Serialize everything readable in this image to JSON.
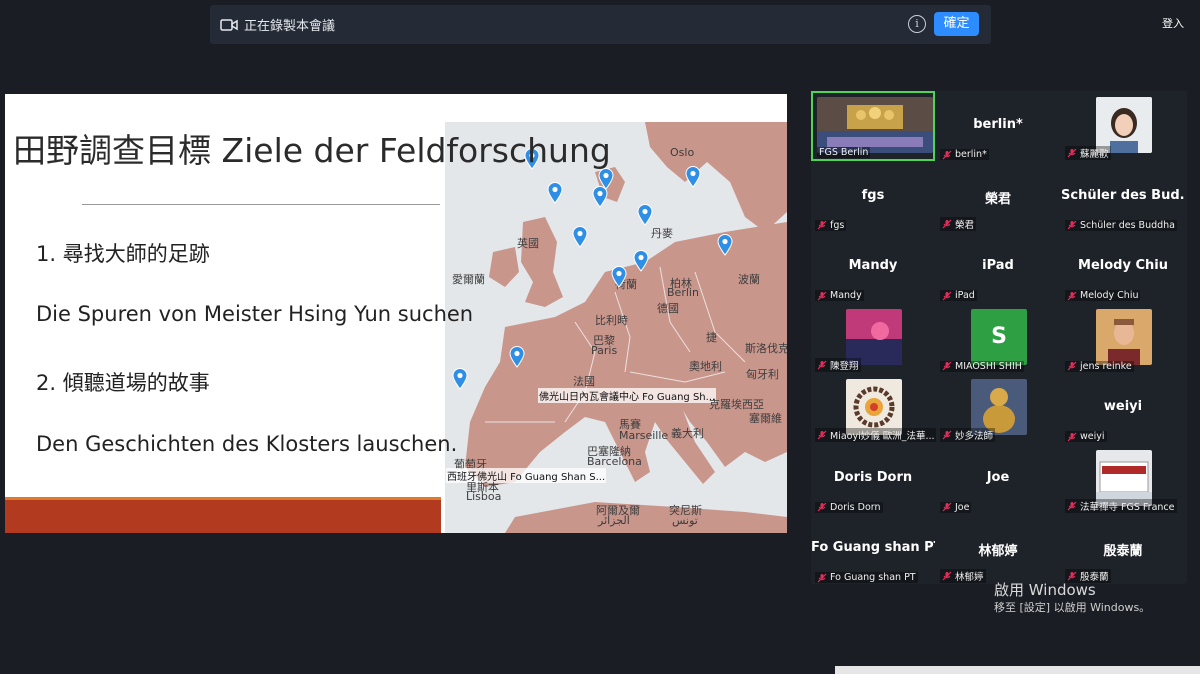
{
  "meeting": {
    "recording_text": "正在錄製本會議",
    "ok_label": "確定",
    "info_glyph": "i",
    "login_label": "登入"
  },
  "slide": {
    "title": "田野調查目標 Ziele der Feldforschung",
    "point1_zh": "1. 尋找大師的足跡",
    "point1_de": "Die Spuren von Meister Hsing Yun suchen",
    "point2_zh": "2. 傾聽道場的故事",
    "point2_de": "Den Geschichten des Klosters lauschen.",
    "map_labels": {
      "oslo": "Oslo",
      "uk": "英國",
      "ireland": "愛爾蘭",
      "denmark": "丹麥",
      "netherlands": "荷蘭",
      "berlin_zh": "柏林",
      "berlin": "Berlin",
      "poland": "波蘭",
      "germany": "德國",
      "belgium": "比利時",
      "paris_zh": "巴黎",
      "paris": "Paris",
      "czech": "捷",
      "slovakia": "斯洛伐克",
      "austria": "奧地利",
      "hungary": "匈牙利",
      "france": "法國",
      "geneva_tag": "佛光山日內瓦會議中心 Fo Guang Sh...",
      "croatia": "克羅埃西亞",
      "serbia": "塞爾維",
      "marseille": "Marseille",
      "italy": "義大利",
      "barcelona_zh": "巴塞隆納",
      "barcelona": "Barcelona",
      "portugal": "葡萄牙",
      "spain_tag": "西班牙佛光山 Fo Guang Shan S...",
      "lisbon_zh": "里斯本",
      "lisbon": "Lisboa",
      "majorca": "馬賽",
      "algeria": "阿爾及爾",
      "algeria_ar": "الجزائر",
      "tunisia": "突尼斯",
      "tunisia_ar": "تونس"
    }
  },
  "gallery": {
    "tiles": [
      {
        "big": "",
        "name": "FGS Berlin",
        "kind": "hall"
      },
      {
        "big": "berlin*",
        "name": "berlin*",
        "kind": "name"
      },
      {
        "big": "",
        "name": "蘇麗歡",
        "kind": "woman"
      },
      {
        "big": "fgs",
        "name": "fgs",
        "kind": "name"
      },
      {
        "big": "榮君",
        "name": "榮君",
        "kind": "name"
      },
      {
        "big": "Schüler des Bud...",
        "name": "Schüler des Buddha",
        "kind": "name"
      },
      {
        "big": "Mandy",
        "name": "Mandy",
        "kind": "name"
      },
      {
        "big": "iPad",
        "name": "iPad",
        "kind": "name"
      },
      {
        "big": "Melody Chiu",
        "name": "Melody Chiu",
        "kind": "name"
      },
      {
        "big": "",
        "name": "陳登翔",
        "kind": "pink"
      },
      {
        "big": "",
        "name": "MIAOSHI SHIH",
        "kind": "letter",
        "letter": "S"
      },
      {
        "big": "",
        "name": "jens reinke",
        "kind": "man"
      },
      {
        "big": "",
        "name": "Miaoyi妙儀 歐洲_法華...",
        "kind": "beads"
      },
      {
        "big": "",
        "name": "妙多法師",
        "kind": "buddha"
      },
      {
        "big": "weiyi",
        "name": "weiyi",
        "kind": "name"
      },
      {
        "big": "Doris Dorn",
        "name": "Doris Dorn",
        "kind": "name"
      },
      {
        "big": "Joe",
        "name": "Joe",
        "kind": "name"
      },
      {
        "big": "",
        "name": "法華禪寺 FGS France",
        "kind": "building"
      },
      {
        "big": "Fo Guang shan PT",
        "name": "Fo Guang shan PT",
        "kind": "name"
      },
      {
        "big": "林郁婷",
        "name": "林郁婷",
        "kind": "name"
      },
      {
        "big": "殷泰蘭",
        "name": "殷泰蘭",
        "kind": "name"
      }
    ]
  },
  "watermark": {
    "title": "啟用 Windows",
    "subtitle": "移至 [設定] 以啟用 Windows。"
  },
  "colors": {
    "accent": "#2d8cff",
    "active_speaker": "#4fd35b",
    "muted_mic": "#e02f5b",
    "map_land": "#c9968c",
    "slide_bar": "#b23a1f"
  }
}
